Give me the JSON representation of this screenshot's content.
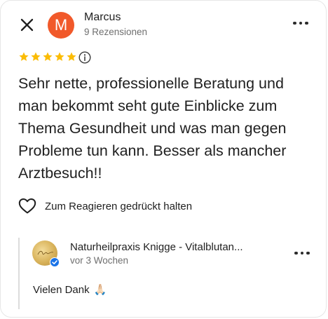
{
  "review": {
    "reviewer_name": "Marcus",
    "reviewer_initial": "M",
    "reviewer_reviews": "9 Rezensionen",
    "rating": 5,
    "rating_max": 5,
    "text": "Sehr nette, professionelle Beratung und man bekommt seht gute Einblicke zum Thema Gesundheit und was man gegen Probleme tun kann. Besser als mancher Arztbesuch!!",
    "react_label": "Zum Reagieren gedrückt halten"
  },
  "owner_reply": {
    "name": "Naturheilpraxis Knigge - Vitalblutan...",
    "date": "vor 3 Wochen",
    "text": "Vielen Dank",
    "emoji": "🙏🏻"
  },
  "icons": {
    "close": "close-icon",
    "more": "more-horizontal-icon",
    "star": "star-icon",
    "info": "info-icon",
    "heart": "heart-outline-icon",
    "verified": "verified-badge-icon"
  },
  "colors": {
    "avatar": "#f1592a",
    "star": "#fbbc04",
    "badge": "#1a73e8",
    "secondary_text": "#6f6f6f"
  }
}
